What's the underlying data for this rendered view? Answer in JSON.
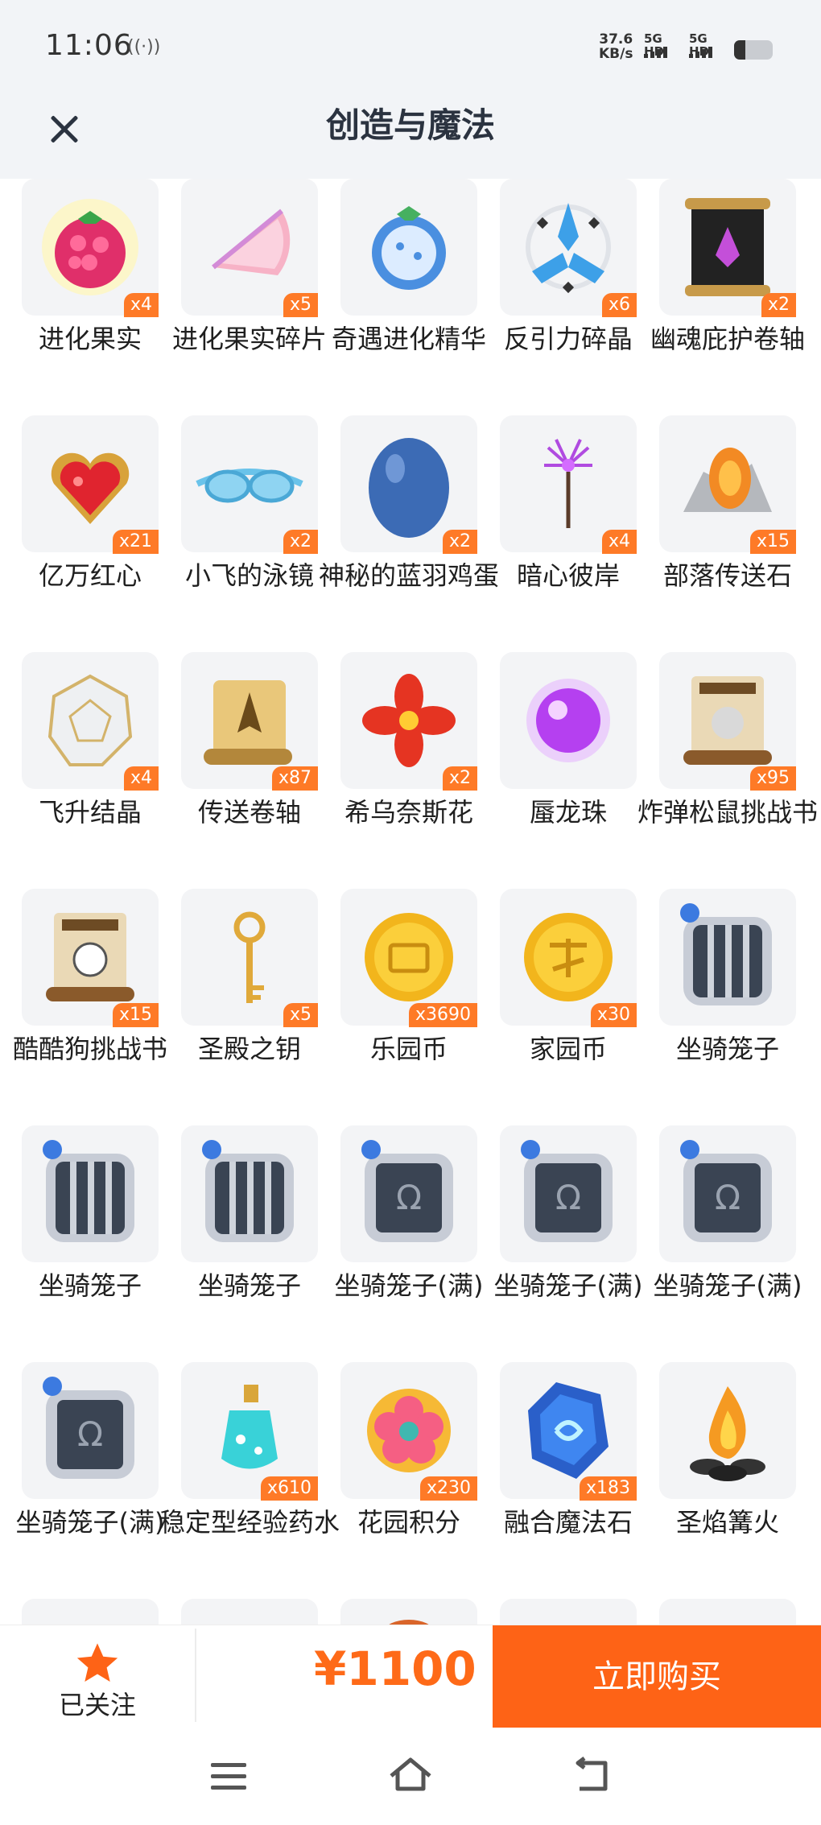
{
  "status_bar": {
    "time": "11:06",
    "nfc_icon": "nfc-icon",
    "net_speed_value": "37.6",
    "net_speed_unit": "KB/s",
    "sim1_label": "5G HD",
    "sim2_label": "5G HD",
    "battery_icon": "battery-icon"
  },
  "header": {
    "title": "创造与魔法",
    "close_icon": "close-icon"
  },
  "items": [
    {
      "name": "进化果实",
      "qty": "x4",
      "icon": "raspberry-fruit-icon"
    },
    {
      "name": "进化果实碎片",
      "qty": "x5",
      "icon": "fruit-slice-icon"
    },
    {
      "name": "奇遇进化精华",
      "qty": "",
      "icon": "blue-fruit-icon"
    },
    {
      "name": "反引力碎晶",
      "qty": "x6",
      "icon": "antigravity-crystal-icon"
    },
    {
      "name": "幽魂庇护卷轴",
      "qty": "x2",
      "icon": "dark-scroll-icon"
    },
    {
      "name": "亿万红心",
      "qty": "x21",
      "icon": "red-heart-gem-icon"
    },
    {
      "name": "小飞的泳镜",
      "qty": "x2",
      "icon": "goggles-icon"
    },
    {
      "name": "神秘的蓝羽鸡蛋",
      "qty": "x2",
      "icon": "blue-egg-icon"
    },
    {
      "name": "暗心彼岸",
      "qty": "x4",
      "icon": "purple-flower-icon"
    },
    {
      "name": "部落传送石",
      "qty": "x15",
      "icon": "teleport-stone-icon"
    },
    {
      "name": "飞升结晶",
      "qty": "x4",
      "icon": "white-crystal-icon"
    },
    {
      "name": "传送卷轴",
      "qty": "x87",
      "icon": "teleport-scroll-icon"
    },
    {
      "name": "希乌奈斯花",
      "qty": "x2",
      "icon": "red-flower-icon"
    },
    {
      "name": "蜃龙珠",
      "qty": "",
      "icon": "purple-orb-icon"
    },
    {
      "name": "炸弹松鼠挑战书",
      "qty": "x95",
      "icon": "wanted-poster-icon"
    },
    {
      "name": "酷酷狗挑战书",
      "qty": "x15",
      "icon": "wanted-poster-icon"
    },
    {
      "name": "圣殿之钥",
      "qty": "x5",
      "icon": "golden-key-icon"
    },
    {
      "name": "乐园币",
      "qty": "x3690",
      "icon": "gold-coin-icon"
    },
    {
      "name": "家园币",
      "qty": "x30",
      "icon": "gold-coin-icon"
    },
    {
      "name": "坐骑笼子",
      "qty": "",
      "icon": "mount-cage-icon"
    },
    {
      "name": "坐骑笼子",
      "qty": "",
      "icon": "mount-cage-icon"
    },
    {
      "name": "坐骑笼子",
      "qty": "",
      "icon": "mount-cage-icon"
    },
    {
      "name": "坐骑笼子(满)",
      "qty": "",
      "icon": "mount-cage-full-icon"
    },
    {
      "name": "坐骑笼子(满)",
      "qty": "",
      "icon": "mount-cage-full-icon"
    },
    {
      "name": "坐骑笼子(满)",
      "qty": "",
      "icon": "mount-cage-full-icon"
    },
    {
      "name": "坐骑笼子(满)",
      "qty": "",
      "icon": "mount-cage-full-icon"
    },
    {
      "name": "稳定型经验药水",
      "qty": "x610",
      "icon": "potion-bottle-icon"
    },
    {
      "name": "花园积分",
      "qty": "x230",
      "icon": "flower-badge-icon"
    },
    {
      "name": "融合魔法石",
      "qty": "x183",
      "icon": "blue-magic-stone-icon"
    },
    {
      "name": "圣焰篝火",
      "qty": "",
      "icon": "campfire-icon"
    }
  ],
  "bottom_bar": {
    "follow_label": "已关注",
    "follow_icon": "star-icon",
    "price": "¥1100",
    "buy_label": "立即购买",
    "accent_color": "#fe6316"
  },
  "nav_bar": {
    "menu_icon": "menu-icon",
    "home_icon": "home-icon",
    "back_icon": "back-icon"
  }
}
